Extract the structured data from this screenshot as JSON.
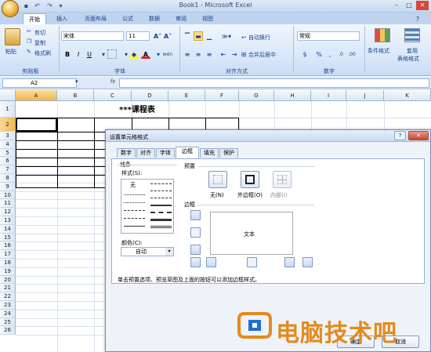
{
  "window": {
    "title": "Book1 - Microsoft Excel"
  },
  "ribbon_tabs": [
    "开始",
    "插入",
    "页面布局",
    "公式",
    "数据",
    "审阅",
    "视图"
  ],
  "clipboard": {
    "paste": "粘贴",
    "cut": "剪切",
    "copy": "复制",
    "format_painter": "格式刷",
    "group_label": "剪贴板"
  },
  "font": {
    "name": "宋体",
    "size": "11",
    "group_label": "字体",
    "bold": "B",
    "italic": "I",
    "underline": "U",
    "grow": "A˄",
    "shrink": "A˅",
    "font_color_letter": "A",
    "phonetic": "wén"
  },
  "alignment": {
    "wrap_text": "自动换行",
    "merge_center": "合并后居中",
    "group_label": "对齐方式"
  },
  "number": {
    "format": "常规",
    "percent": "%",
    "comma": ",",
    "group_label": "数字",
    "currency": "$"
  },
  "styles": {
    "conditional_format": "条件格式",
    "table_format_1": "套用",
    "table_format_2": "表格格式"
  },
  "formula_bar": {
    "cell_ref": "A2",
    "fx": "fx",
    "content": ""
  },
  "sheet": {
    "columns": [
      "A",
      "B",
      "C",
      "D",
      "E",
      "F",
      "G",
      "H",
      "I",
      "J",
      "K"
    ],
    "rows": [
      "1",
      "2",
      "3",
      "4",
      "5",
      "6",
      "7",
      "8",
      "9",
      "10",
      "11",
      "12",
      "13",
      "14",
      "15",
      "16",
      "17",
      "18",
      "19",
      "20",
      "21",
      "22",
      "23",
      "24",
      "25",
      "26"
    ],
    "title_cell": "***课程表"
  },
  "dialog": {
    "title": "设置单元格格式",
    "tabs": [
      "数字",
      "对齐",
      "字体",
      "边框",
      "填充",
      "保护"
    ],
    "active_tab": "边框",
    "line_section": "线条",
    "style_label": "样式(S):",
    "none_style": "无",
    "color_label": "颜色(C):",
    "color_value": "自动",
    "presets_label": "预置",
    "preset_none": "无(N)",
    "preset_outline": "外边框(O)",
    "preset_inside": "内部(I)",
    "border_label": "边框",
    "preview_text": "文本",
    "hint": "单击预置选项、预览草图及上面的按钮可以添加边框样式。",
    "ok": "确定",
    "cancel": "取消"
  },
  "watermark": {
    "text": "电脑技术吧"
  }
}
